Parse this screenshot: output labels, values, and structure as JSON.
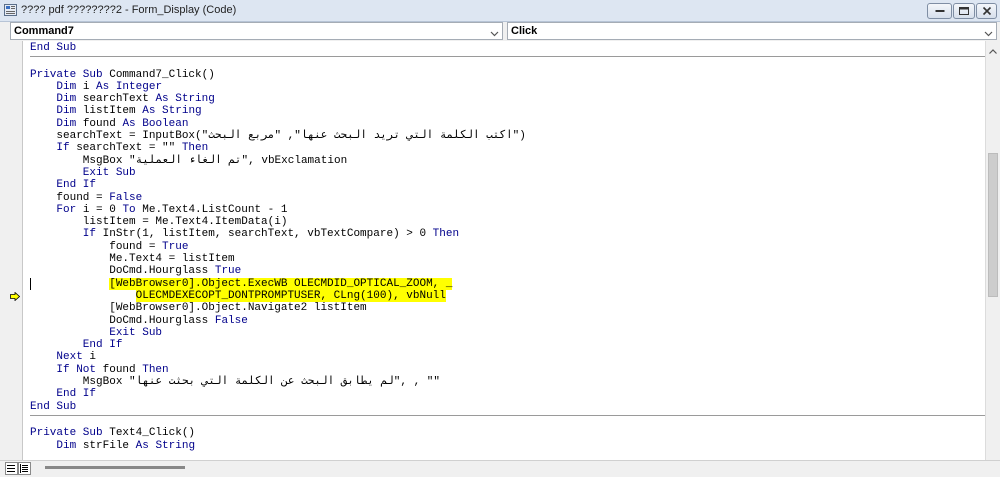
{
  "window": {
    "title": "???? pdf ????????2 - Form_Display (Code)"
  },
  "dropdowns": {
    "object_value": "Command7",
    "procedure_value": "Click"
  },
  "code_lines": [
    "End Sub",
    "",
    "Private Sub Command7_Click()",
    "    Dim i As Integer",
    "    Dim searchText As String",
    "    Dim listItem As String",
    "    Dim found As Boolean",
    "    searchText = InputBox(\"اكتب الكلمة التي تريد البحث عنها\", \"مربع البحث\")",
    "    If searchText = \"\" Then",
    "        MsgBox \"تم الغاء العملية\", vbExclamation",
    "        Exit Sub",
    "    End If",
    "    found = False",
    "    For i = 0 To Me.Text4.ListCount - 1",
    "        listItem = Me.Text4.ItemData(i)",
    "        If InStr(1, listItem, searchText, vbTextCompare) > 0 Then",
    "            found = True",
    "            Me.Text4 = listItem",
    "            DoCmd.Hourglass True",
    "            [WebBrowser0].Object.ExecWB OLECMDID_OPTICAL_ZOOM, _",
    "                OLECMDEXECOPT_DONTPROMPTUSER, CLng(100), vbNull",
    "            [WebBrowser0].Object.Navigate2 listItem",
    "            DoCmd.Hourglass False",
    "            Exit Sub",
    "        End If",
    "    Next i",
    "    If Not found Then",
    "        MsgBox \"لم يطابق البحث عن الكلمة التي بحثت عنها\", , \"\"",
    "    End If",
    "End Sub",
    "",
    "Private Sub Text4_Click()",
    "    Dim strFile As String"
  ],
  "colors": {
    "keyword": "#00008b",
    "highlight": "#ffff00",
    "exec_arrow": "#ffff00"
  },
  "icons": {
    "execution_point": "execution-arrow-icon",
    "minimize": "minimize-icon",
    "maximize": "maximize-icon",
    "close": "close-icon"
  }
}
